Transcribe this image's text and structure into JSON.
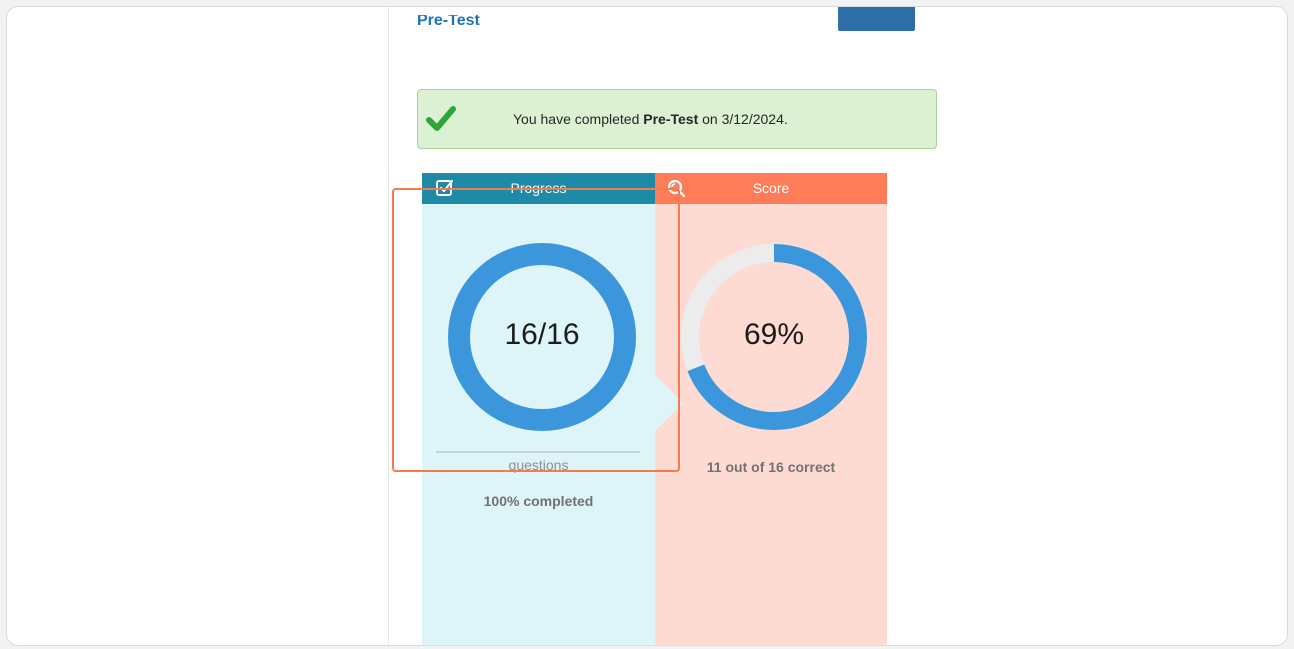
{
  "page": {
    "title": "Pre-Test"
  },
  "alert": {
    "prefix": "You have completed ",
    "test_name": "Pre-Test",
    "suffix": " on 3/12/2024.",
    "icon": "check-icon",
    "color": "#2da637"
  },
  "progress": {
    "header": "Progress",
    "icon": "checkbox-edit-icon",
    "value_label": "16/16",
    "completed": 16,
    "total": 16,
    "unit_label": "questions",
    "completed_label": "100% completed",
    "color": "#3b96dc"
  },
  "score": {
    "header": "Score",
    "icon": "search-icon",
    "value_label": "69%",
    "percent": 69,
    "detail_label": "11 out of 16 correct",
    "color": "#3b96dc",
    "track_color": "#ececec"
  },
  "colors": {
    "progress_header": "#1e8aa8",
    "score_header": "#ff7c58",
    "highlight": "#f37b52",
    "title": "#1f73b7"
  }
}
